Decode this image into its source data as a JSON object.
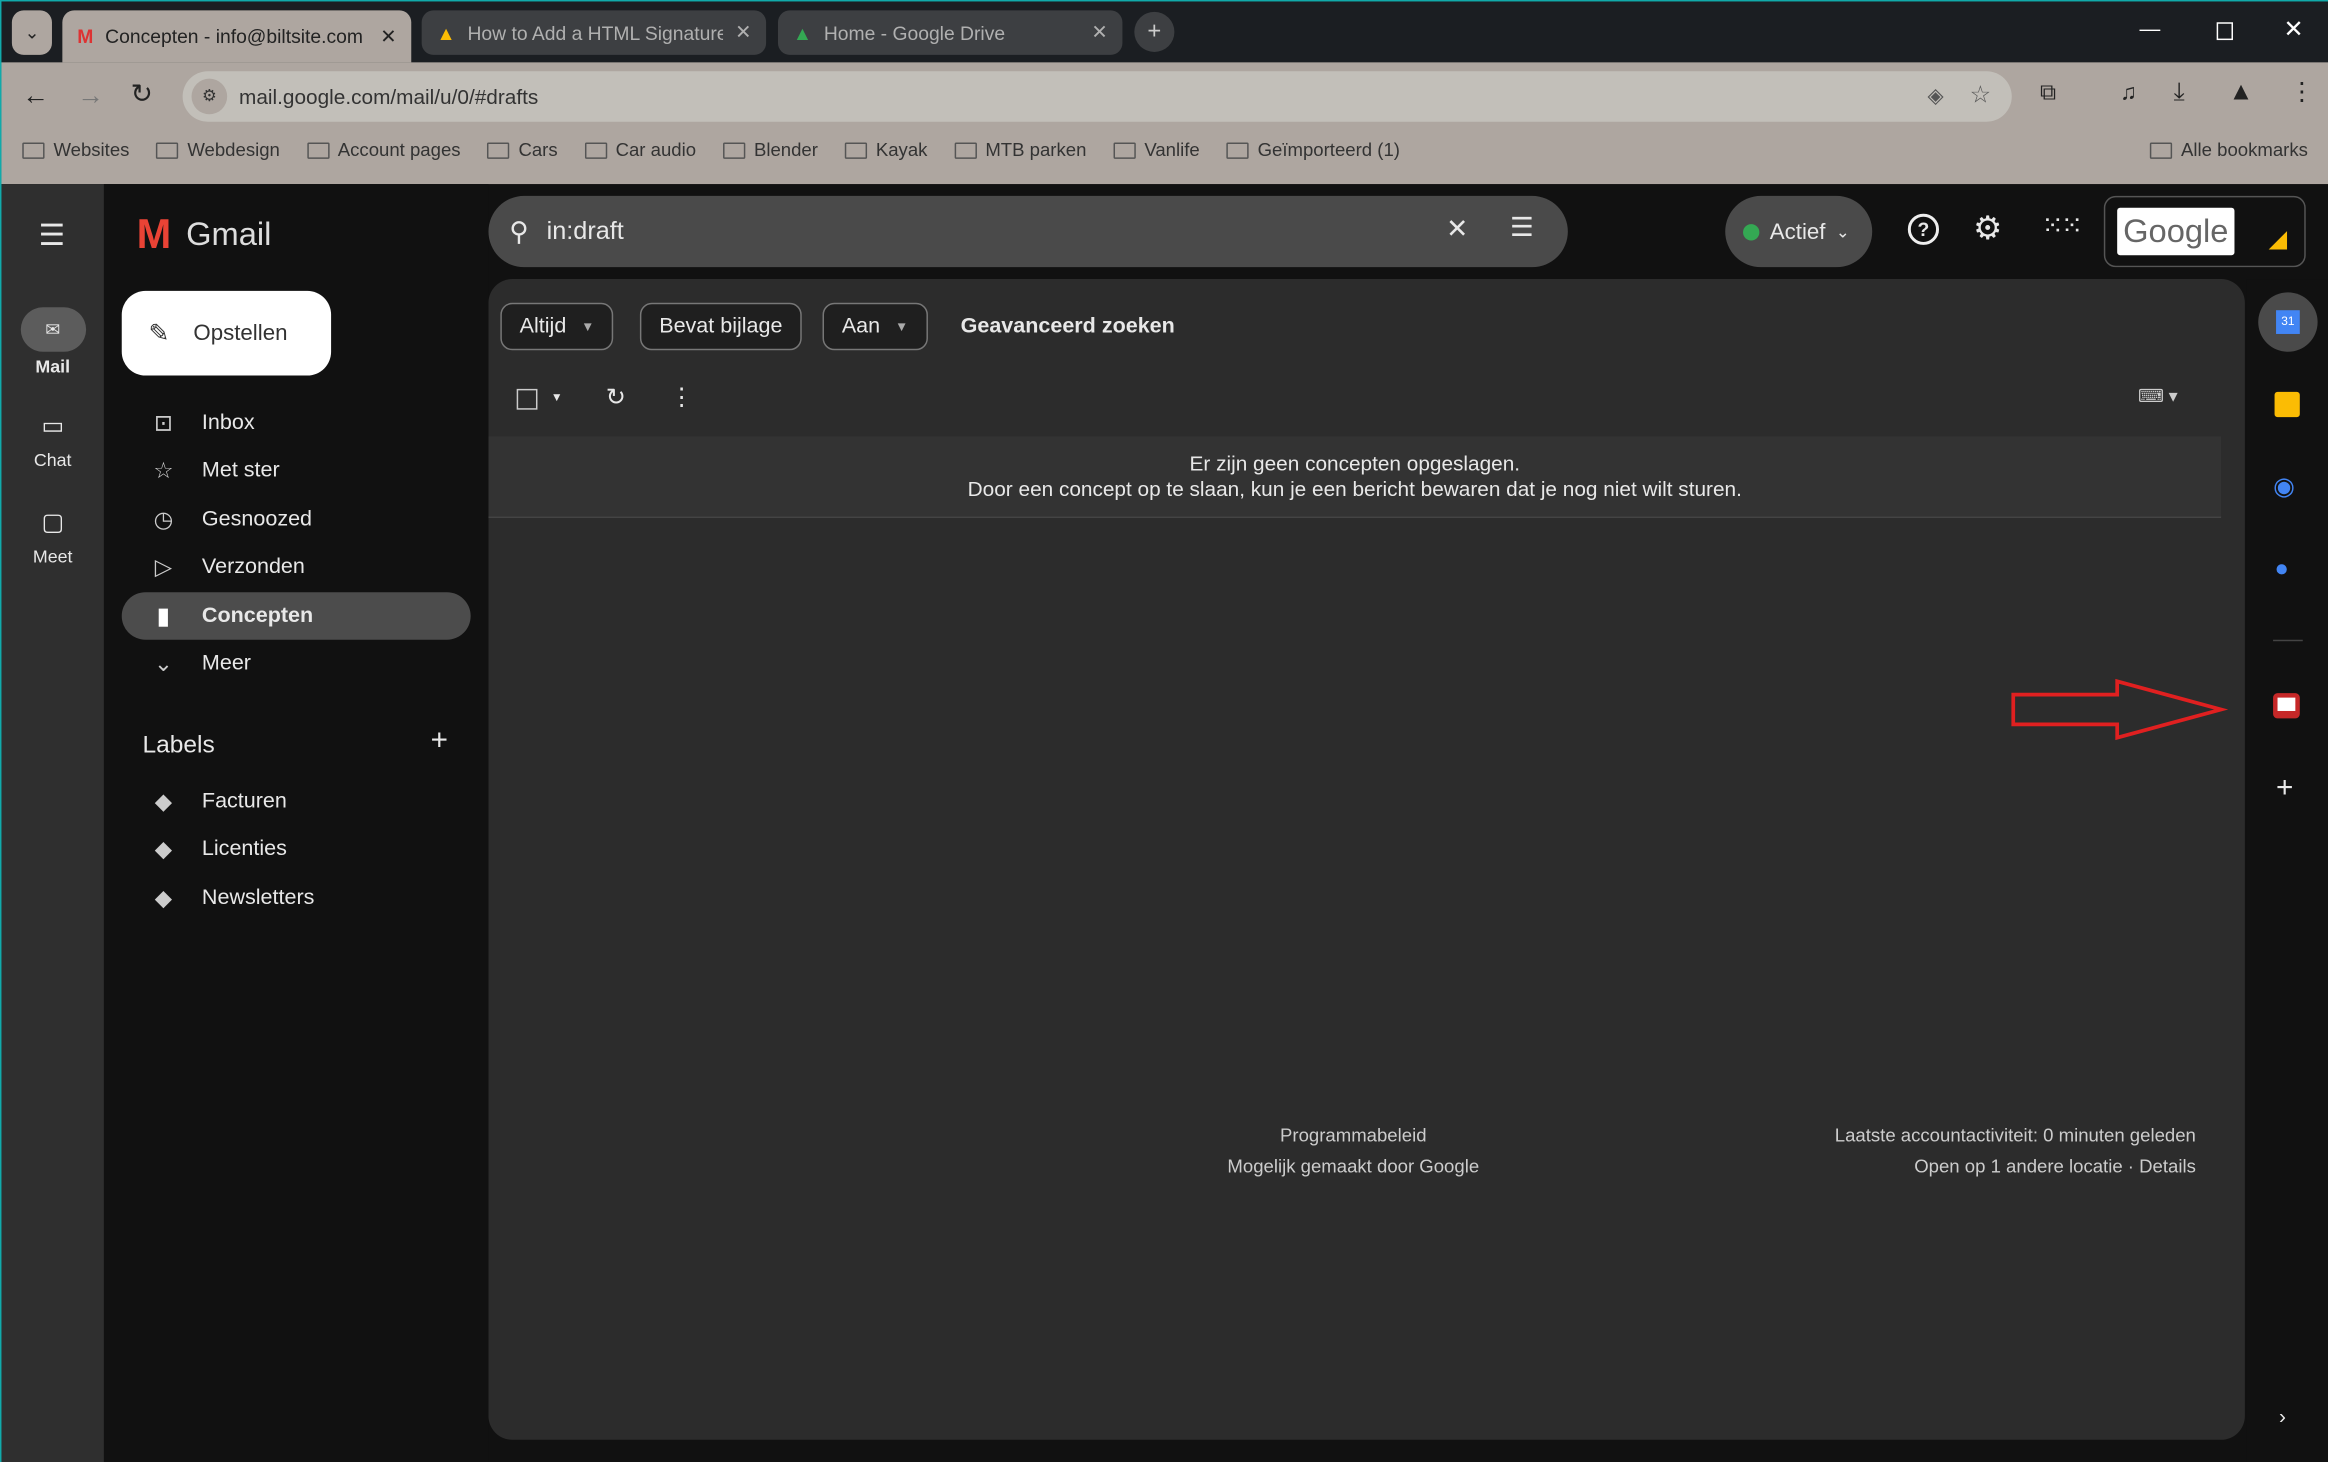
{
  "browser": {
    "tabs": [
      {
        "label": "Concepten - info@biltsite.com",
        "active": true,
        "icon": "gmail-icon"
      },
      {
        "label": "How to Add a HTML Signature",
        "active": false,
        "icon": "alfred-icon"
      },
      {
        "label": "Home - Google Drive",
        "active": false,
        "icon": "google-drive-icon"
      }
    ],
    "url": "mail.google.com/mail/u/0/#drafts",
    "bookmarks": [
      "Websites",
      "Webdesign",
      "Account pages",
      "Cars",
      "Car audio",
      "Blender",
      "Kayak",
      "MTB parken",
      "Vanlife",
      "Geïmporteerd (1)"
    ],
    "all_bookmarks": "Alle bookmarks"
  },
  "rail": [
    {
      "label": "Mail",
      "icon": "mail-icon",
      "active": true
    },
    {
      "label": "Chat",
      "icon": "chat-icon"
    },
    {
      "label": "Meet",
      "icon": "video-icon"
    }
  ],
  "app": {
    "name": "Gmail"
  },
  "search": {
    "value": "in:draft"
  },
  "status": {
    "label": "Actief",
    "color": "#34a853"
  },
  "compose": "Opstellen",
  "nav": [
    {
      "label": "Inbox",
      "icon": "inbox-icon"
    },
    {
      "label": "Met ster",
      "icon": "star-icon"
    },
    {
      "label": "Gesnoozed",
      "icon": "clock-icon"
    },
    {
      "label": "Verzonden",
      "icon": "send-icon"
    },
    {
      "label": "Concepten",
      "icon": "draft-icon",
      "selected": true
    },
    {
      "label": "Meer",
      "icon": "chevron-down-icon"
    }
  ],
  "labels": {
    "title": "Labels",
    "items": [
      "Facturen",
      "Licenties",
      "Newsletters"
    ]
  },
  "filters": {
    "time": "Altijd",
    "attachment": "Bevat bijlage",
    "to": "Aan",
    "advanced": "Geavanceerd zoeken"
  },
  "empty": {
    "line1": "Er zijn geen concepten opgeslagen.",
    "line2": "Door een concept op te slaan, kun je een bericht bewaren dat je nog niet wilt sturen."
  },
  "footer": {
    "policy": "Programmabeleid",
    "powered": "Mogelijk gemaakt door Google",
    "activity": "Laatste accountactiviteit: 0 minuten geleden",
    "open": "Open op 1 andere locatie · Details"
  },
  "account": {
    "logo": "Google"
  },
  "annotation_color": "#e02020"
}
